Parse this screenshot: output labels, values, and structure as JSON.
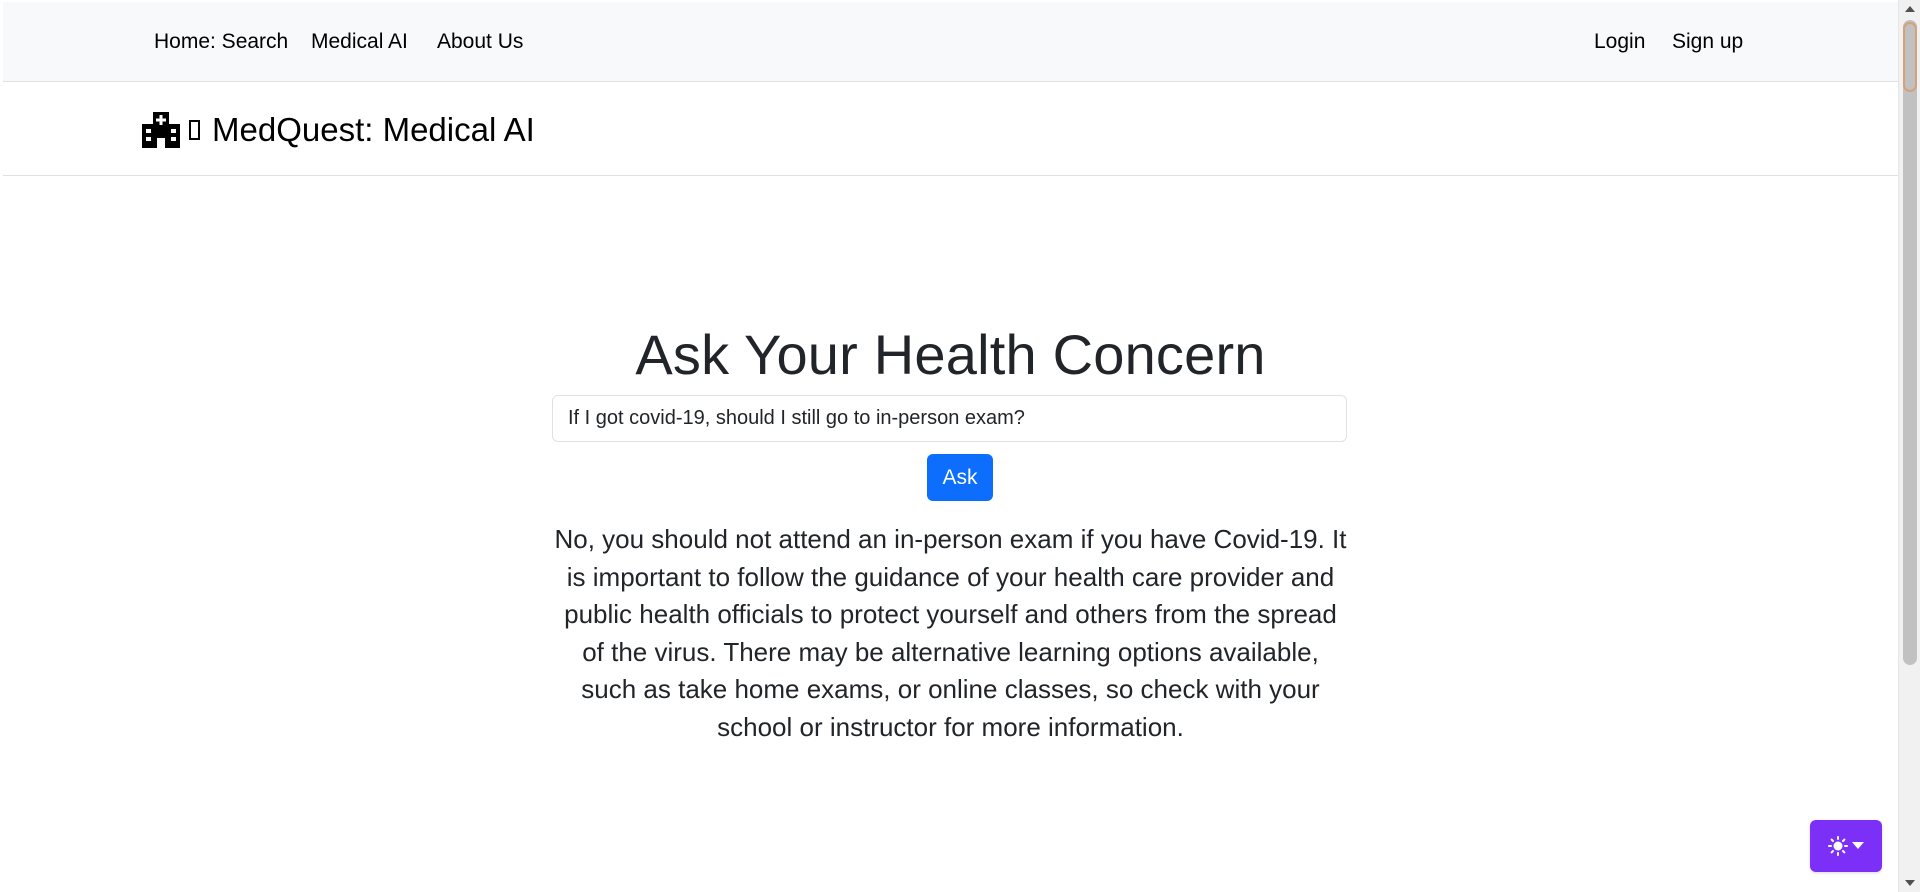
{
  "nav": {
    "links": [
      {
        "label": "Home: Search"
      },
      {
        "label": "Medical AI"
      },
      {
        "label": "About Us"
      }
    ],
    "auth": {
      "login_label": "Login",
      "signup_label": "Sign up"
    }
  },
  "brand": {
    "icon": "hospital-icon",
    "title": "MedQuest: Medical AI"
  },
  "main": {
    "heading": "Ask Your Health Concern",
    "question_value": "If I got covid-19, should I still go to in-person exam?",
    "ask_label": "Ask",
    "answer": "No, you should not attend an in-person exam if you have Covid-19. It is important to follow the guidance of your health care provider and public health officials to protect yourself and others from the spread of the virus. There may be alternative learning options available, such as take home exams, or online classes, so check with your school or instructor for more information."
  },
  "theme_toggle": {
    "icon": "sun-icon",
    "dropdown_icon": "caret-down-icon"
  },
  "colors": {
    "primary": "#0d6efd",
    "theme_toggle_bg": "#7b2ff7",
    "nav_bg": "#f8f9fa"
  }
}
